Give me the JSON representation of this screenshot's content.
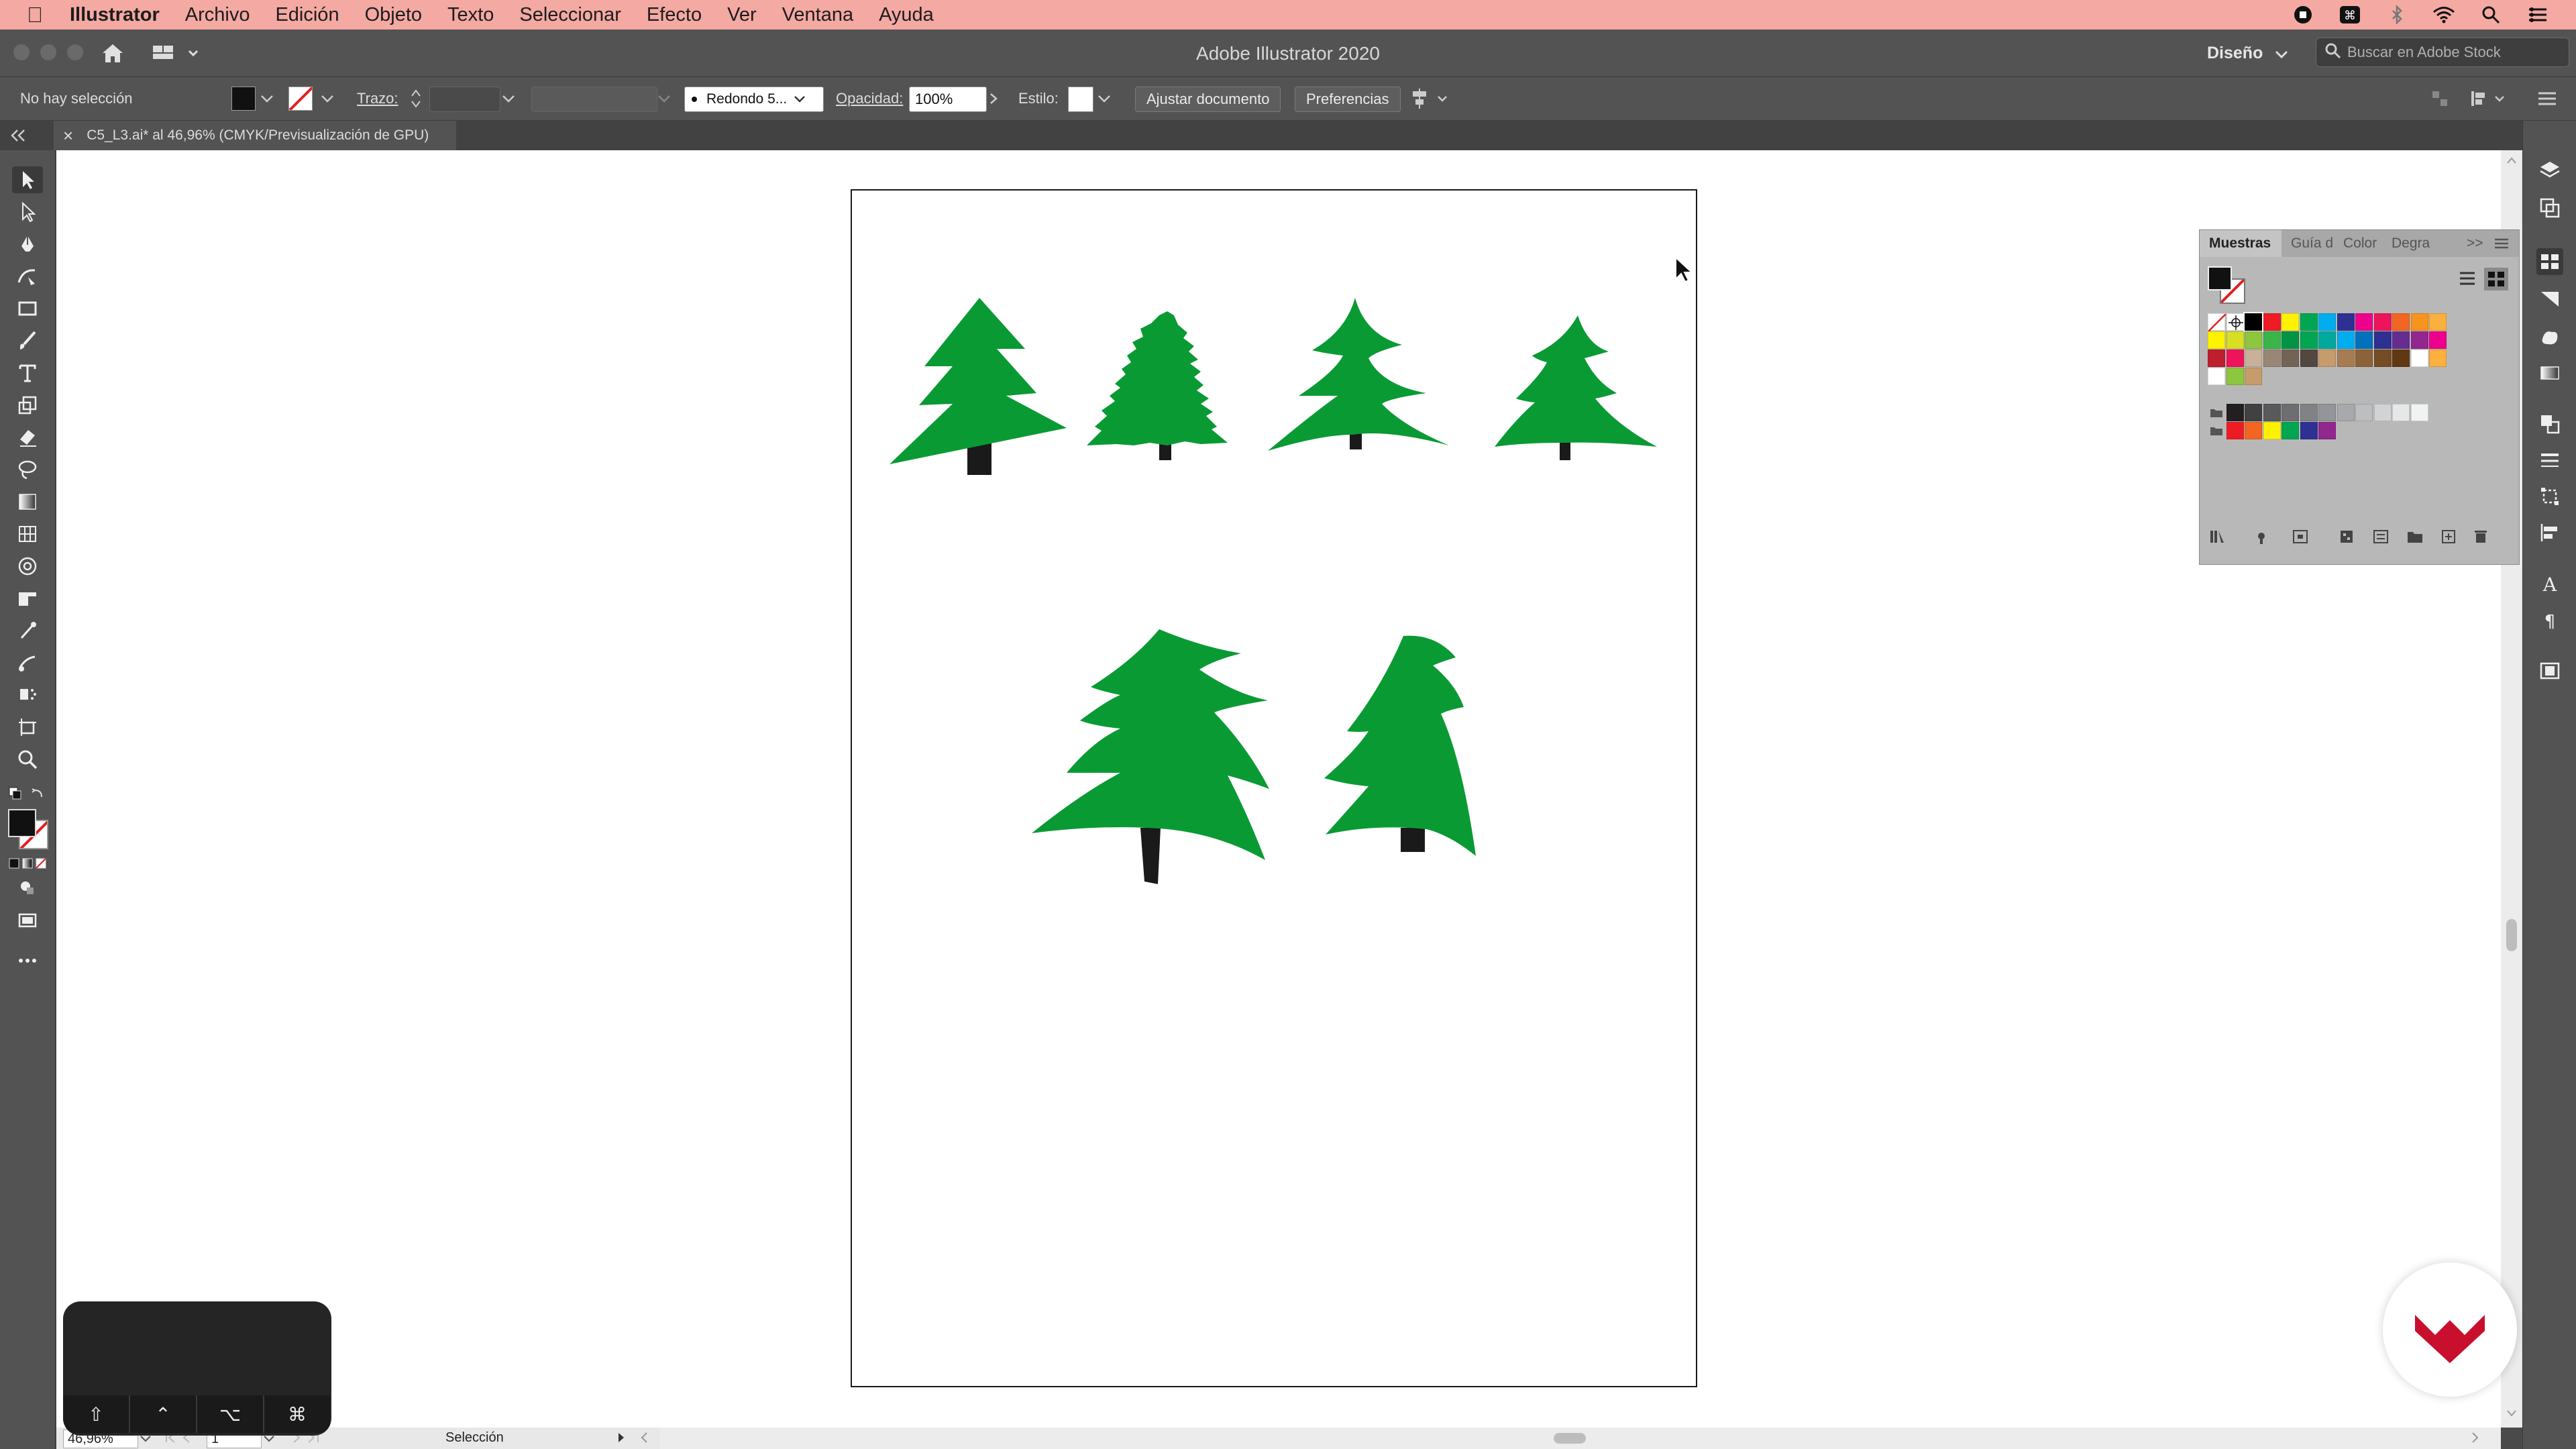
{
  "menubar": {
    "app_name": "Illustrator",
    "items": [
      "Archivo",
      "Edición",
      "Objeto",
      "Texto",
      "Seleccionar",
      "Efecto",
      "Ver",
      "Ventana",
      "Ayuda"
    ]
  },
  "window": {
    "title": "Adobe Illustrator 2020",
    "workspace": "Diseño",
    "search_placeholder": "Buscar en Adobe Stock"
  },
  "control_bar": {
    "selection_status": "No hay selección",
    "stroke_label": "Trazo:",
    "brush_label": "Redondo 5...",
    "opacity_label": "Opacidad:",
    "opacity_value": "100%",
    "style_label": "Estilo:",
    "fit_document_button": "Ajustar documento",
    "preferences_button": "Preferencias"
  },
  "document_tab": {
    "close": "×",
    "title": "C5_L3.ai* al 46,96% (CMYK/Previsualización de GPU)"
  },
  "swatches_panel": {
    "tabs": [
      "Muestras",
      "Guía d",
      "Color",
      "Degra"
    ],
    "collapse": ">>",
    "rows": [
      [
        "#ffffff",
        "#ffffff",
        "#000000",
        "#ed1c24",
        "#fff200",
        "#00a651",
        "#00aeef",
        "#2e3192",
        "#ec008c",
        "#ed145b",
        "#f26522",
        "#f7941d",
        "#fbaf3f"
      ],
      [
        "#fff200",
        "#d7df23",
        "#8dc63f",
        "#39b54a",
        "#009444",
        "#00a651",
        "#00a99d",
        "#00aeef",
        "#0072bc",
        "#2e3192",
        "#662d91",
        "#92278f",
        "#ec008c"
      ],
      [
        "#be1e2d",
        "#ed145b",
        "#c7b299",
        "#998675",
        "#736357",
        "#534741",
        "#c69c6d",
        "#a67c52",
        "#8c6239",
        "#754c24",
        "#603913",
        "#ffffff",
        "#fbb040"
      ],
      [
        "#ffffff",
        "#8dc63f",
        "#c69c6d"
      ],
      [
        "#231f20",
        "#414042",
        "#58595b",
        "#6d6e71",
        "#808285",
        "#939598",
        "#a7a9ac",
        "#bcbec0",
        "#d1d3d4",
        "#e6e7e8",
        "#f1f2f2"
      ],
      [
        "#ed1c24",
        "#f26522",
        "#fff200",
        "#00a651",
        "#2e3192",
        "#92278f"
      ]
    ]
  },
  "status_bar": {
    "zoom": "46,96%",
    "artboard_number": "1",
    "current_tool": "Selección"
  },
  "keyboard_overlay": {
    "keys": [
      "⇧",
      "⌃",
      "⌥",
      "⌘"
    ]
  },
  "colors": {
    "tree_green": "#0a9a34",
    "trunk": "#1a1a1a",
    "menubar": "#f4a9a3",
    "ui_gray": "#535353",
    "logo_red": "#c8102e"
  }
}
